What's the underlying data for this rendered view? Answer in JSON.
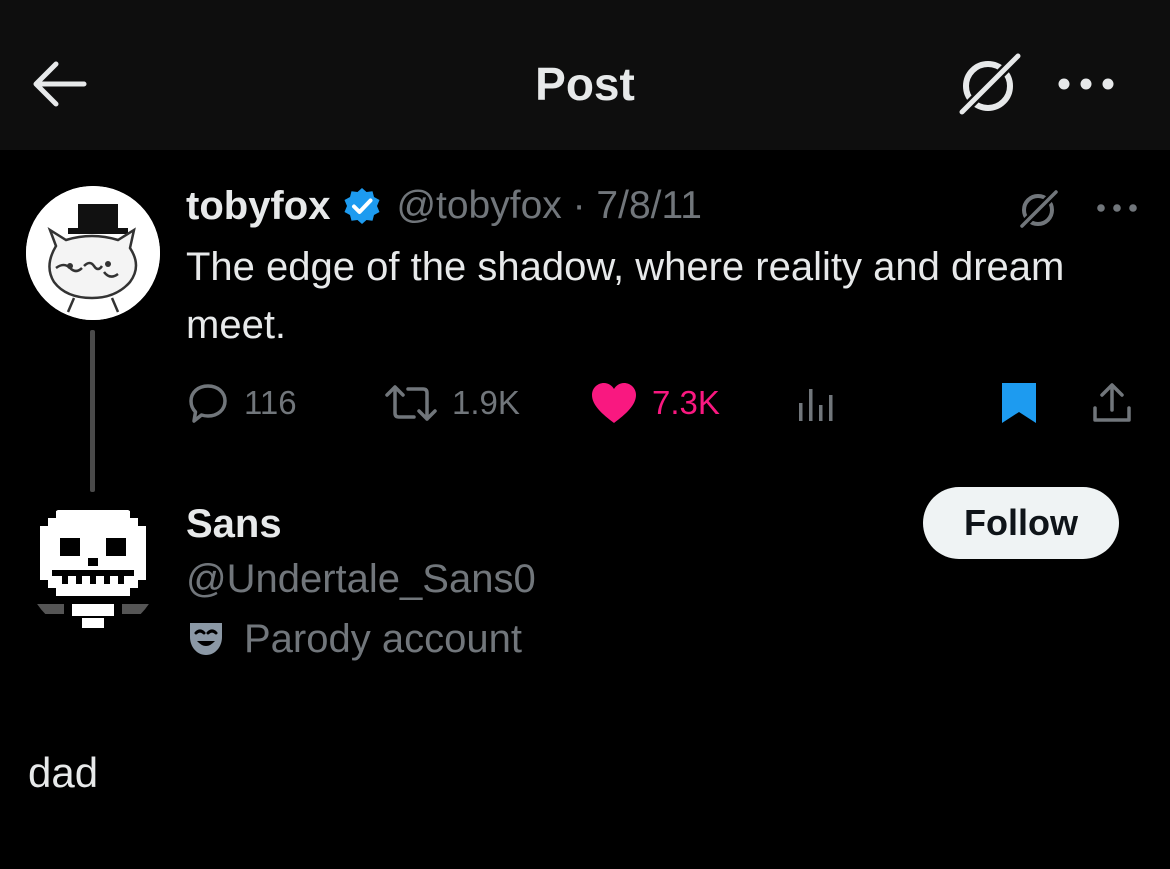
{
  "header": {
    "title": "Post",
    "back_icon": "arrow-left-icon",
    "grok_icon": "grok-icon",
    "more_icon": "more-horizontal-icon"
  },
  "parent_tweet": {
    "display_name": "tobyfox",
    "verified": true,
    "handle_date": "@tobyfox · 7/8/11",
    "text": "The edge of the shadow, where reality and dream meet.",
    "replies": "116",
    "reposts": "1.9K",
    "likes": "7.3K",
    "liked": true,
    "bookmarked": true
  },
  "account": {
    "display_name": "Sans",
    "handle": "@Undertale_Sans0",
    "label": "Parody account",
    "follow_label": "Follow"
  },
  "reply": {
    "text": "dad"
  },
  "colors": {
    "background": "#000000",
    "header_bg": "#0e0e0e",
    "text_primary": "#e7e9ea",
    "text_secondary": "#71767b",
    "like_pink": "#f91880",
    "accent_blue": "#1d9bf0"
  }
}
